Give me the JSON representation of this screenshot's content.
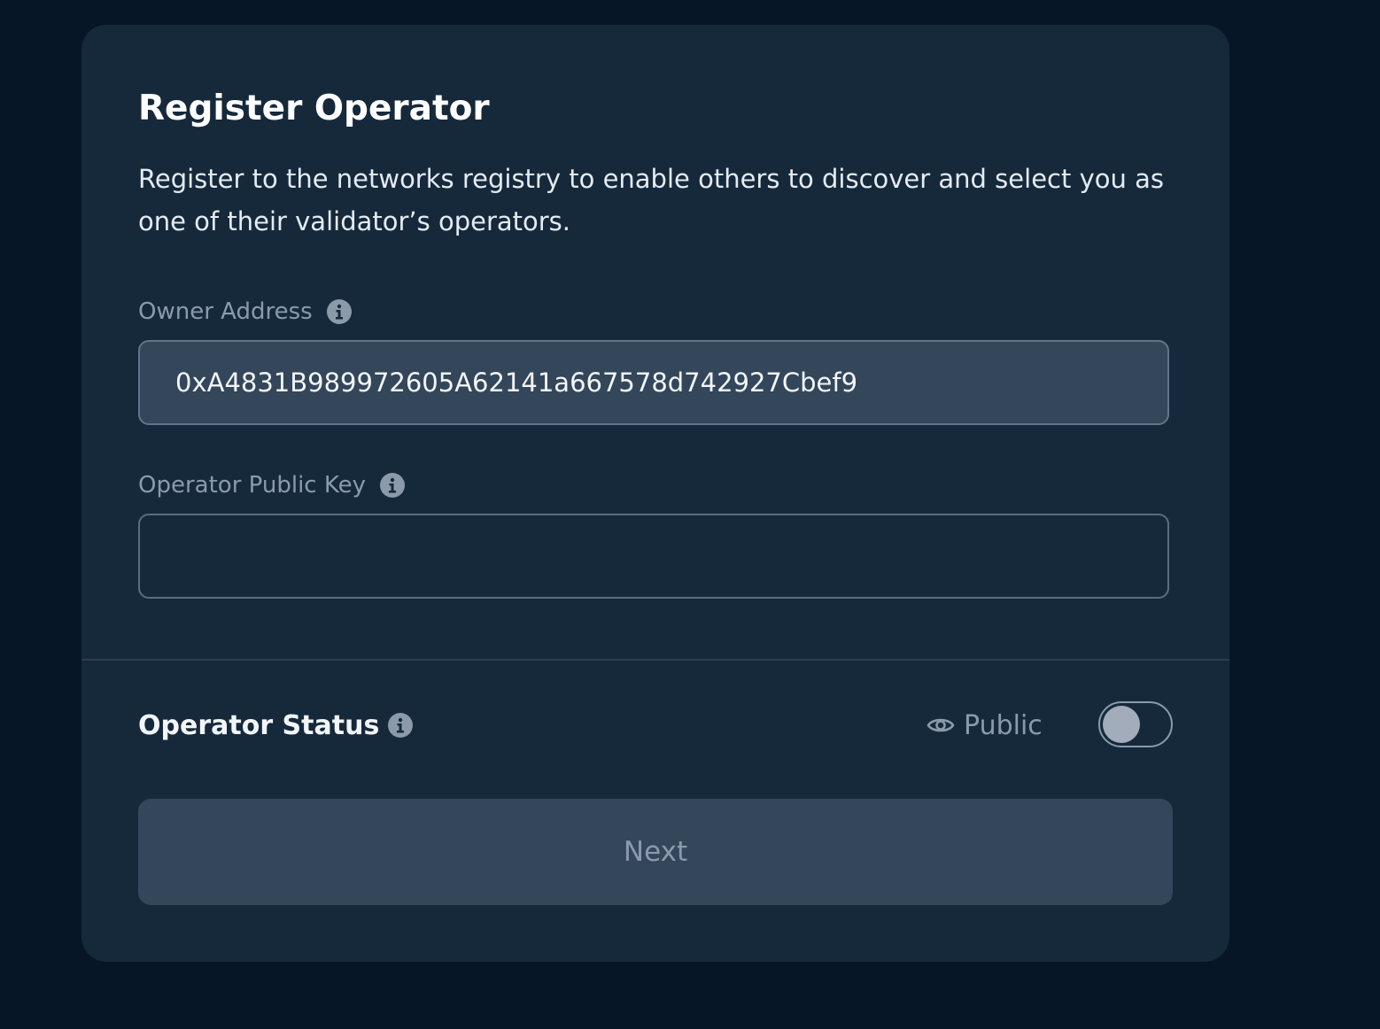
{
  "form": {
    "title": "Register Operator",
    "description": "Register to the networks registry to enable others to discover and select you as one of their validator’s operators.",
    "owner_address": {
      "label": "Owner Address",
      "value": "0xA4831B989972605A62141a667578d742927Cbef9",
      "info_icon": "info-icon"
    },
    "public_key": {
      "label": "Operator Public Key",
      "value": "",
      "placeholder": "",
      "info_icon": "info-icon"
    },
    "status": {
      "label": "Operator Status",
      "visibility_label": "Public",
      "visibility_icon": "eye-icon",
      "toggle_on": false
    },
    "next_button": {
      "label": "Next",
      "disabled": true
    }
  },
  "colors": {
    "page_background": "#061626",
    "card_background": "#16293b",
    "input_filled_background": "#34465a",
    "muted_text": "#8a9aab",
    "primary_text": "#ffffff"
  }
}
